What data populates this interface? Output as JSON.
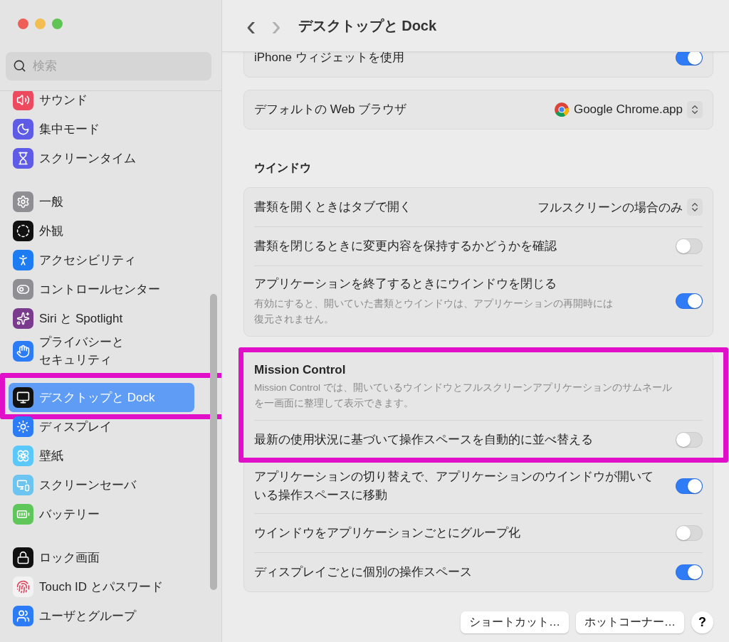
{
  "sidebar": {
    "search": {
      "placeholder": "検索"
    },
    "groups": [
      {
        "items": [
          {
            "label": "サウンド",
            "color": "#ee4a5f",
            "selected": false
          },
          {
            "label": "集中モード",
            "color": "#5e5ce6",
            "selected": false
          },
          {
            "label": "スクリーンタイム",
            "color": "#5e5ce6",
            "selected": false
          }
        ]
      },
      {
        "items": [
          {
            "label": "一般",
            "color": "#8e8e93",
            "selected": false
          },
          {
            "label": "外観",
            "color": "#111111",
            "selected": false
          },
          {
            "label": "アクセシビリティ",
            "color": "#1e7cf2",
            "selected": false
          },
          {
            "label": "コントロールセンター",
            "color": "#8e8e93",
            "selected": false
          },
          {
            "label": "Siri と Spotlight",
            "color": "#7a3b8f",
            "selected": false
          },
          {
            "lines": [
              "プライバシーと",
              "セキュリティ"
            ],
            "color": "#2b7cf6",
            "selected": false
          }
        ]
      },
      {
        "items": [
          {
            "label": "デスクトップと Dock",
            "color": "#111111",
            "selected": true
          },
          {
            "label": "ディスプレイ",
            "color": "#2b7cf6",
            "selected": false
          },
          {
            "label": "壁紙",
            "color": "#5ac8fa",
            "selected": false
          },
          {
            "label": "スクリーンセーバ",
            "color": "#6cc4f0",
            "selected": false
          },
          {
            "label": "バッテリー",
            "color": "#5fc65a",
            "selected": false
          }
        ]
      },
      {
        "items": [
          {
            "label": "ロック画面",
            "color": "#111111",
            "selected": false
          },
          {
            "label": "Touch ID とパスワード",
            "color": "#f2f2f2",
            "selected": false
          },
          {
            "label": "ユーザとグループ",
            "color": "#2b7cf6",
            "selected": false
          }
        ]
      }
    ]
  },
  "header": {
    "back": "‹",
    "forward": "›",
    "title": "デスクトップと Dock"
  },
  "sections": [
    {
      "rows": [
        {
          "kind": "toggle",
          "label": "iPhone ウィジェットを使用",
          "on": true
        }
      ]
    },
    {
      "rows": [
        {
          "kind": "popup",
          "label": "デフォルトの Web ブラウザ",
          "value": "Google Chrome.app",
          "app_icon": true
        }
      ]
    },
    {
      "title": "ウインドウ",
      "rows": [
        {
          "kind": "popup",
          "label": "書類を開くときはタブで開く",
          "value": "フルスクリーンの場合のみ"
        },
        {
          "kind": "toggle",
          "label": "書類を閉じるときに変更内容を保持するかどうかを確認",
          "on": false
        },
        {
          "kind": "toggle",
          "label": "アプリケーションを終了するときにウインドウを閉じる",
          "on": true,
          "note": "有効にすると、開いていた書類とウインドウは、アプリケーションの再開時には復元されません。"
        }
      ]
    },
    {
      "card_title": "Mission Control",
      "card_note": "Mission Control では、開いているウインドウとフルスクリーンアプリケーションのサムネールを一画面に整理して表示できます。",
      "rows": [
        {
          "kind": "toggle",
          "label": "最新の使用状況に基づいて操作スペースを自動的に並べ替える",
          "on": false
        },
        {
          "kind": "toggle",
          "label": "アプリケーションの切り替えで、アプリケーションのウインドウが開いている操作スペースに移動",
          "on": true
        },
        {
          "kind": "toggle",
          "label": "ウインドウをアプリケーションごとにグループ化",
          "on": false
        },
        {
          "kind": "toggle",
          "label": "ディスプレイごとに個別の操作スペース",
          "on": true
        }
      ]
    }
  ],
  "footer": {
    "buttons": [
      "ショートカット…",
      "ホットコーナー…"
    ],
    "help": "?"
  }
}
